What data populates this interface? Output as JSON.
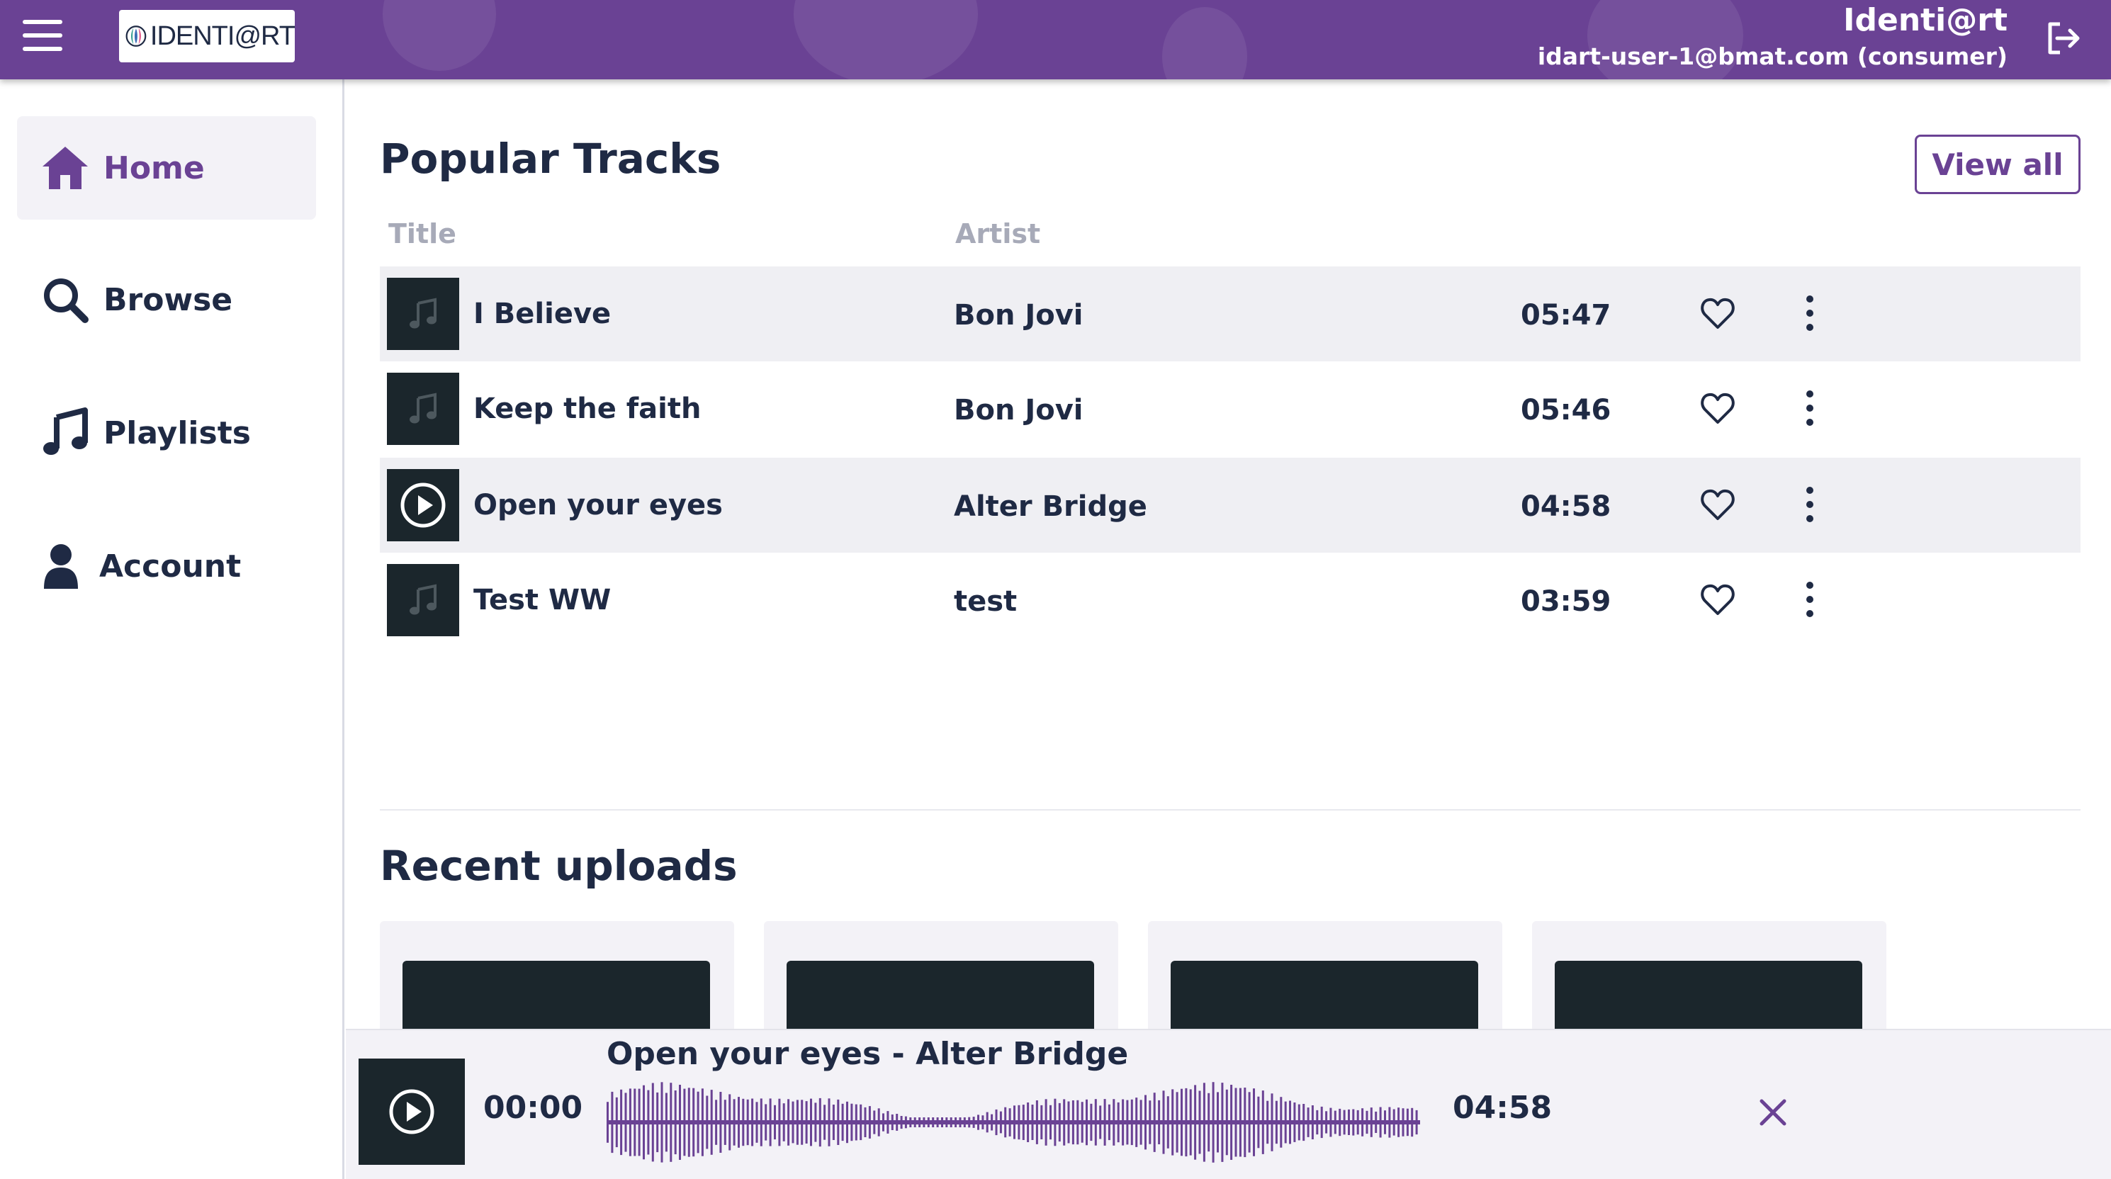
{
  "header": {
    "logo_text": "IDENTI@RT",
    "user_name": "Identi@rt",
    "user_email": "idart-user-1@bmat.com (consumer)"
  },
  "sidebar": {
    "items": [
      {
        "label": "Home",
        "icon": "home-icon",
        "active": true
      },
      {
        "label": "Browse",
        "icon": "search-icon",
        "active": false
      },
      {
        "label": "Playlists",
        "icon": "music-note-icon",
        "active": false
      },
      {
        "label": "Account",
        "icon": "user-icon",
        "active": false
      }
    ]
  },
  "popular": {
    "title": "Popular Tracks",
    "view_all_label": "View all",
    "columns": {
      "title": "Title",
      "artist": "Artist"
    },
    "tracks": [
      {
        "title": "I Believe",
        "artist": "Bon Jovi",
        "duration": "05:47",
        "playing": false
      },
      {
        "title": "Keep the faith",
        "artist": "Bon Jovi",
        "duration": "05:46",
        "playing": false
      },
      {
        "title": "Open your eyes",
        "artist": "Alter Bridge",
        "duration": "04:58",
        "playing": true
      },
      {
        "title": "Test WW",
        "artist": "test",
        "duration": "03:59",
        "playing": false
      }
    ]
  },
  "recent": {
    "title": "Recent uploads"
  },
  "player": {
    "track": "Open your eyes - Alter Bridge",
    "current_time": "00:00",
    "total_time": "04:58"
  },
  "colors": {
    "brand": "#6a4294",
    "dark": "#1b262c",
    "text": "#1f2a44",
    "muted": "#a7aab8",
    "row_shade": "#efeff3"
  }
}
